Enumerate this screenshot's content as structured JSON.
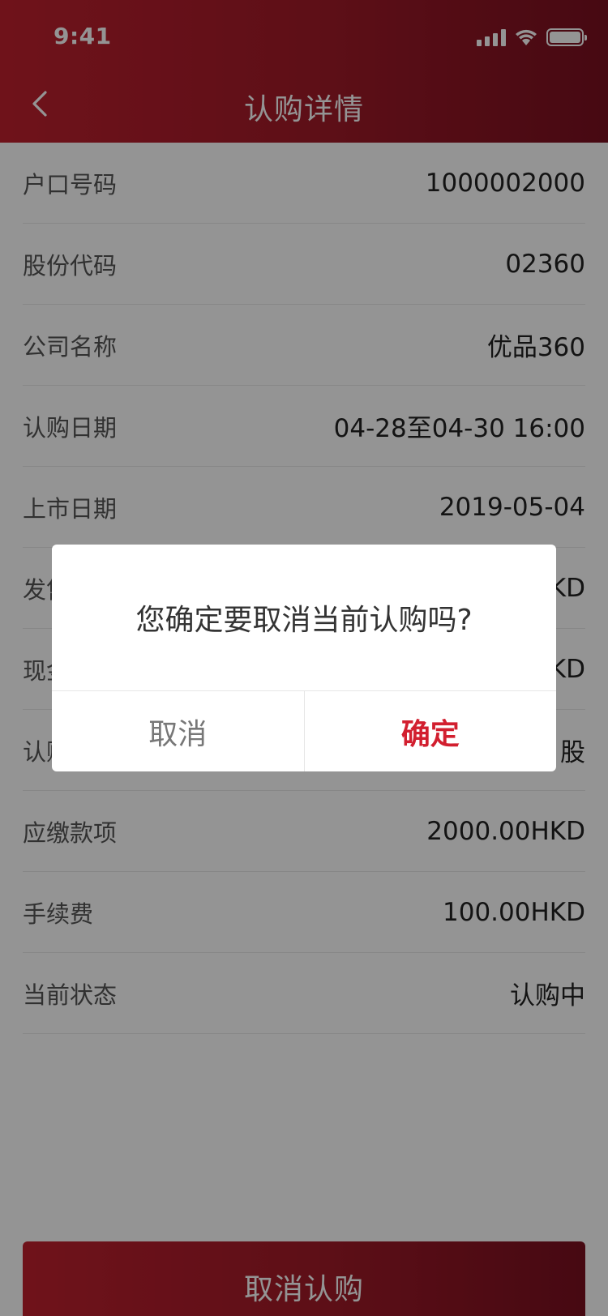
{
  "status_bar": {
    "time": "9:41"
  },
  "header": {
    "title": "认购详情"
  },
  "details": [
    {
      "label": "户口号码",
      "value": "1000002000"
    },
    {
      "label": "股份代码",
      "value": "02360"
    },
    {
      "label": "公司名称",
      "value": "优品360"
    },
    {
      "label": "认购日期",
      "value": "04-28至04-30 16:00"
    },
    {
      "label": "上市日期",
      "value": "2019-05-04"
    },
    {
      "label": "发售价",
      "value": "HKD"
    },
    {
      "label": "现金",
      "value": "HKD"
    },
    {
      "label": "认购",
      "value": "股"
    },
    {
      "label": "应缴款项",
      "value": "2000.00HKD"
    },
    {
      "label": "手续费",
      "value": "100.00HKD"
    },
    {
      "label": "当前状态",
      "value": "认购中"
    }
  ],
  "action": {
    "cancel_subscription_label": "取消认购"
  },
  "dialog": {
    "message": "您确定要取消当前认购吗?",
    "cancel_label": "取消",
    "confirm_label": "确定"
  }
}
